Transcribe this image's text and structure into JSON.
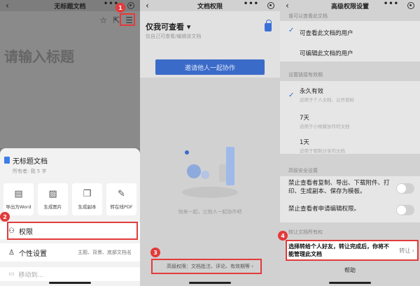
{
  "panel1": {
    "title": "无标题文档",
    "dots": "•••",
    "editor_placeholder": "请输入标题",
    "doc": {
      "name": "无标题文档",
      "sub": "所有者: 我  5 字"
    },
    "tiles": [
      {
        "icon": "word-icon",
        "label": "导出为Word"
      },
      {
        "icon": "image-icon",
        "label": "生成图片"
      },
      {
        "icon": "copy-icon",
        "label": "生成副本"
      },
      {
        "icon": "pdf-icon",
        "label": "转在线PDF"
      }
    ],
    "permission_label": "权限",
    "personalize_label": "个性设置",
    "personalize_value": "主题、背景、底部文档名",
    "move_label": "移动到..."
  },
  "panel2": {
    "title": "文档权限",
    "dots": "•••",
    "heading": "仅我可查看",
    "heading_caret": "▾",
    "subtext": "仅自己可查看/编辑该文档",
    "invite_button": "邀请他人一起协作",
    "empty_text": "快来一起，让他人一起协作吧",
    "advanced_link": "高级权限：文档批注、评论、有效期等 ›"
  },
  "panel3": {
    "title": "高级权限设置",
    "dots": "•••",
    "cap_who": "谁可以查看此文档",
    "opt_view": "可查看此文档的用户",
    "opt_edit": "可编辑此文档的用户",
    "cap_valid": "设置链接有效期",
    "valid_forever": "永久有效",
    "valid_forever_desc": "适用于个人文档、公开资料",
    "valid_7": "7天",
    "valid_7_desc": "适用于小规模协作的文档",
    "valid_1": "1天",
    "valid_1_desc": "适用于限制分享的文档",
    "cap_security": "高级安全设置",
    "security_1": "禁止查看者复制、导出、下载附件、打印、生成副本、保存为模板。",
    "security_2": "禁止查看者申请编辑权限。",
    "cap_transfer": "转让文档所有权",
    "transfer_highlight": "选择转给个人好友，转让完成后，你将不能管理此文档",
    "transfer_action": "转让 ›",
    "help": "帮助"
  },
  "badges": [
    "1",
    "2",
    "3",
    "4"
  ],
  "colors": {
    "badge": "#e23b3b",
    "accent": "#3b6bc9"
  }
}
